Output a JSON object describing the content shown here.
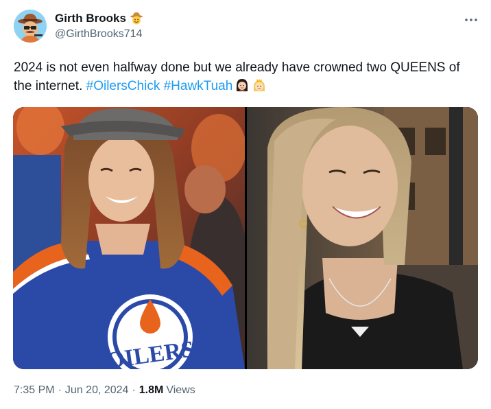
{
  "author": {
    "display_name": "Girth Brooks",
    "handle": "@GirthBrooks714",
    "badge_icon": "cowboy-face-emoji",
    "avatar_icon": "cartoon-cowboy-avatar"
  },
  "menu_icon": "more-options-icon",
  "tweet": {
    "text_part1": "2024 is not even halfway done but we already have crowned two QUEENS of the internet.",
    "hashtag1": "#OilersChick",
    "hashtag2": "#HawkTuah",
    "emojis": [
      "woman-dark-hair-emoji",
      "princess-emoji"
    ]
  },
  "media": {
    "left_image": {
      "description_icon": "photo-woman-oilers-jersey",
      "jersey_text": "OILERS"
    },
    "right_image": {
      "description_icon": "photo-woman-smiling-black-top"
    }
  },
  "meta": {
    "time": "7:35 PM",
    "date": "Jun 20, 2024",
    "views_count": "1.8M",
    "views_label": "Views"
  },
  "colors": {
    "hashtag": "#1d9bf0",
    "secondary_text": "#536471",
    "primary_text": "#0f1419",
    "oilers_blue": "#2b4aa8",
    "oilers_orange": "#e8631c"
  }
}
